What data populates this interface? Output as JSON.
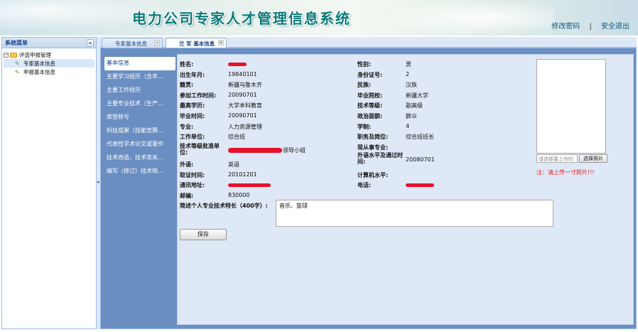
{
  "header": {
    "title": "电力公司专家人才管理信息系统",
    "change_password": "修改密码",
    "separator": "|",
    "logout": "安全退出"
  },
  "sidebar": {
    "title": "系统菜单",
    "collapse": "«",
    "tree": {
      "root": "评选申报管理",
      "items": [
        "专家基本信息",
        "申报基本信息"
      ]
    }
  },
  "tabs": [
    {
      "label": "专家基本信息",
      "active": false
    },
    {
      "label": "兰 军 基本信息",
      "active": true
    }
  ],
  "subnav": [
    "基本信息",
    "主要学习经历（含丰...",
    "主要工作经历",
    "主要专业技术（生产...",
    "荣誉称号",
    "科技成果（技能竞赛...",
    "代表性学术论文或著作",
    "技术改造、技术攻关...",
    "编写（修订）技术规..."
  ],
  "form": {
    "left": [
      {
        "label": "姓名:",
        "value": ""
      },
      {
        "label": "出生年月:",
        "value": "19840101"
      },
      {
        "label": "籍贯:",
        "value": "新疆乌鲁木齐"
      },
      {
        "label": "参加工作时间:",
        "value": "20090701"
      },
      {
        "label": "最高学历:",
        "value": "大学本科教育"
      },
      {
        "label": "毕业时间:",
        "value": "20090701"
      },
      {
        "label": "专业:",
        "value": "人力资源管理"
      },
      {
        "label": "工作单位:",
        "value": "综合班"
      },
      {
        "label": "技术等级批准单位:",
        "value": "领导小组"
      },
      {
        "label": "外语:",
        "value": "英语"
      },
      {
        "label": "取证时间:",
        "value": "20101201"
      },
      {
        "label": "通讯地址:",
        "value": ""
      },
      {
        "label": "邮编:",
        "value": "830000"
      }
    ],
    "right": [
      {
        "label": "性别:",
        "value": "男"
      },
      {
        "label": "身份证号:",
        "value": "2"
      },
      {
        "label": "民族:",
        "value": "汉族"
      },
      {
        "label": "毕业院校:",
        "value": "新疆大学"
      },
      {
        "label": "技术等级:",
        "value": "副高级"
      },
      {
        "label": "政治面貌:",
        "value": "群众"
      },
      {
        "label": "学制:",
        "value": "4"
      },
      {
        "label": "职务及岗位:",
        "value": "综合班班长"
      },
      {
        "label": "现从事专业:",
        "value": ""
      },
      {
        "label": "外语水平及通过时间:",
        "value": "20080701"
      },
      {
        "label": "计算机水平:",
        "value": ""
      },
      {
        "label": "电话:",
        "value": ""
      }
    ],
    "skills_label": "简述个人专业技术特长（400字）:",
    "skills_value": "音乐、篮球",
    "save": "保存"
  },
  "photo": {
    "placeholder": "请选择要上传的",
    "button": "选择照片",
    "note": "注：请上传一寸照片!!!"
  },
  "colors": {
    "content_bg": "#6a8ec1",
    "form_bg": "#dfe8f6",
    "redaction": "#e8102a",
    "title": "#0b7a7a"
  }
}
